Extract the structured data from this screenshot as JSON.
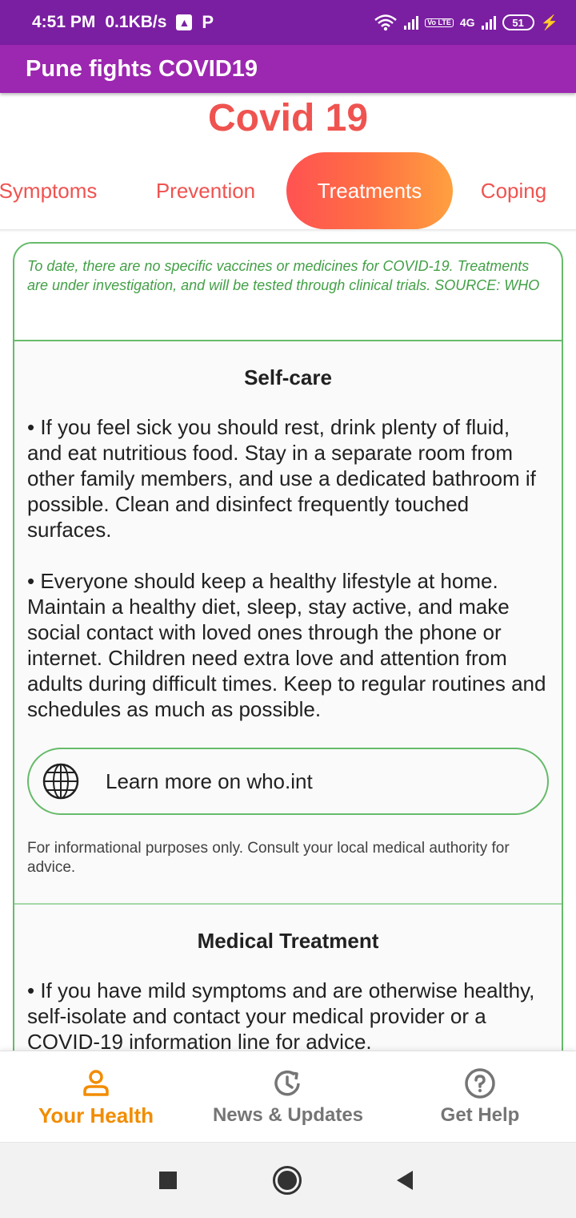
{
  "status_bar": {
    "time": "4:51 PM",
    "speed": "0.1KB/s",
    "p_icon": "P",
    "lte": "Vo LTE",
    "network": "4G",
    "battery": "51"
  },
  "app_bar": {
    "title": "Pune fights COVID19"
  },
  "page_title": "Covid 19",
  "tabs": [
    {
      "label": "Symptoms"
    },
    {
      "label": "Prevention"
    },
    {
      "label": "Treatments"
    },
    {
      "label": "Coping"
    }
  ],
  "active_tab": "Treatments",
  "note": {
    "text": "To date, there are no specific vaccines or medicines for COVID-19. Treatments are under investigation, and will be tested through clinical trials. SOURCE: WHO"
  },
  "self_care": {
    "title": "Self-care",
    "bullets": [
      " • If you feel sick you should rest, drink plenty of fluid, and eat nutritious food. Stay in a separate room from other family members, and use a dedicated bathroom if possible. Clean and disinfect frequently touched surfaces.",
      " • Everyone should keep a healthy lifestyle at home. Maintain a healthy diet, sleep, stay active, and make social contact with loved ones through the phone or internet. Children need extra love and attention from adults during difficult times. Keep to regular routines and schedules as much as possible."
    ],
    "learn_more": "Learn more on who.int",
    "disclaimer": "For informational purposes only. Consult your local medical authority for advice."
  },
  "medical_treatment": {
    "title": "Medical Treatment",
    "bullets": [
      " • If you have mild symptoms and are otherwise healthy, self-isolate and contact your medical provider or a COVID-19 information line for advice."
    ]
  },
  "bottom_nav": [
    {
      "label": "Your Health",
      "icon": "person-icon"
    },
    {
      "label": "News & Updates",
      "icon": "history-icon"
    },
    {
      "label": "Get Help",
      "icon": "help-circle-icon"
    }
  ],
  "colors": {
    "status_bar": "#7b1fa2",
    "app_bar": "#9c27b0",
    "accent_red": "#ef5350",
    "green": "#66bb6a",
    "nav_active": "#f28c00"
  }
}
